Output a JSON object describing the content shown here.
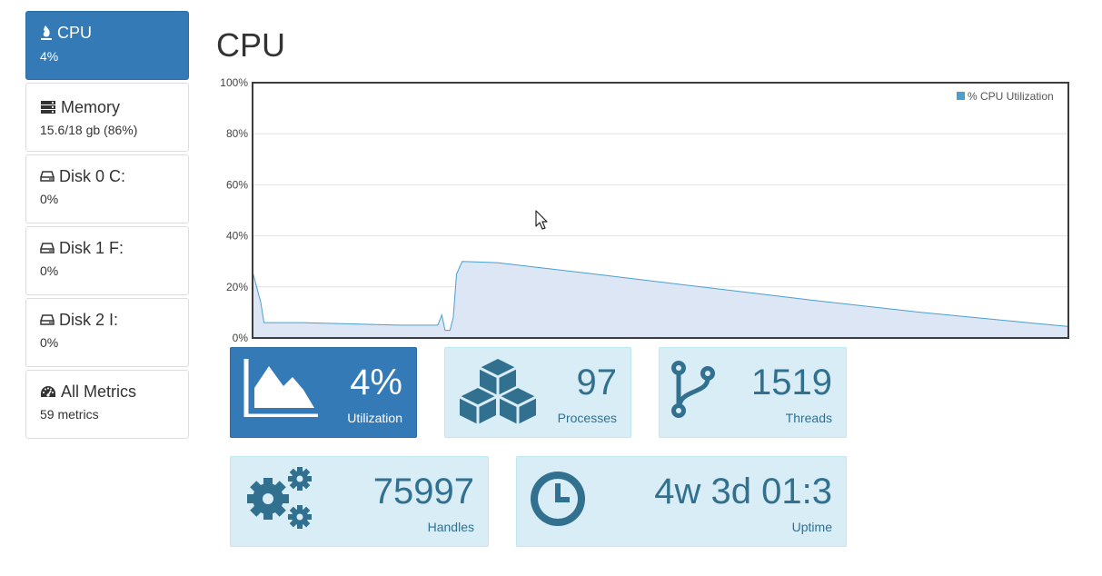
{
  "sidebar": {
    "items": [
      {
        "label": "CPU",
        "sub": "4%",
        "icon": "flame-icon",
        "active": true
      },
      {
        "label": "Memory",
        "sub": "15.6/18 gb (86%)",
        "icon": "memory-icon"
      },
      {
        "label": "Disk 0 C:",
        "sub": "0%",
        "icon": "hard-drive-icon"
      },
      {
        "label": "Disk 1 F:",
        "sub": "0%",
        "icon": "hard-drive-icon"
      },
      {
        "label": "Disk 2 I:",
        "sub": "0%",
        "icon": "hard-drive-icon"
      },
      {
        "label": "All Metrics",
        "sub": "59 metrics",
        "icon": "dashboard-icon"
      }
    ]
  },
  "main": {
    "title": "CPU"
  },
  "chart_data": {
    "type": "area",
    "title": "",
    "xlabel": "",
    "ylabel": "",
    "ylim": [
      0,
      100
    ],
    "yticks": [
      "0%",
      "20%",
      "40%",
      "60%",
      "80%",
      "100%"
    ],
    "grid": true,
    "legend": "top-right",
    "series": [
      {
        "name": "% CPU Utilization",
        "color": "#4a9fcf",
        "fill": "#dce6f4",
        "values": [
          26,
          14,
          6,
          6,
          5.5,
          5,
          5,
          9,
          3,
          3,
          8,
          25,
          30,
          29.5,
          25,
          20,
          15,
          10,
          4.5
        ]
      }
    ]
  },
  "tiles": {
    "utilization": {
      "value": "4%",
      "label": "Utilization",
      "icon": "area-chart-icon"
    },
    "processes": {
      "value": "97",
      "label": "Processes",
      "icon": "cubes-icon"
    },
    "threads": {
      "value": "1519",
      "label": "Threads",
      "icon": "code-fork-icon"
    },
    "handles": {
      "value": "75997",
      "label": "Handles",
      "icon": "gears-icon"
    },
    "uptime": {
      "value": "4w 3d 01:3",
      "label": "Uptime",
      "icon": "clock-icon"
    }
  },
  "colors": {
    "accent": "#337ab7",
    "tile_bg": "#d9edf7",
    "tile_text": "#31708f"
  }
}
